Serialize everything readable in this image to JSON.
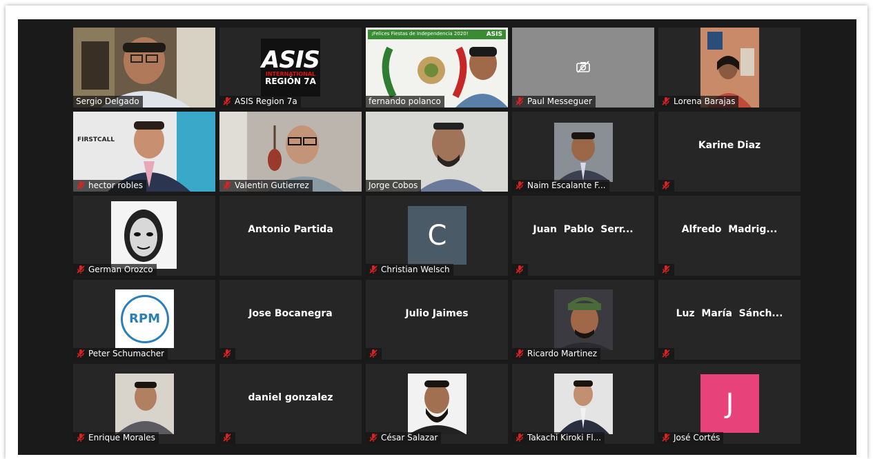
{
  "colors": {
    "stage_bg": "#1a1a1a",
    "tile_bg": "#262626",
    "active_speaker_border": "#c8e64c",
    "mic_muted": "#e02020",
    "avatar_c": "#4a5a66",
    "avatar_j": "#e8427a"
  },
  "tiles": [
    {
      "name": "Sergio Delgado",
      "muted": false
    },
    {
      "name": "ASIS Region 7a",
      "muted": true,
      "logo": {
        "line1": "ASIS",
        "line2": "INTERNATIONAL",
        "line3": "REGIÓN 7A"
      }
    },
    {
      "name": "fernando polanco",
      "muted": false,
      "active": true,
      "banner": "¡Felices Fiestas de Independencia 2020!",
      "banner_logo": "ASIS"
    },
    {
      "name": "Paul Messeguer",
      "muted": true,
      "camera_off": true
    },
    {
      "name": "Lorena Barajas",
      "muted": true
    },
    {
      "name": "hector robles",
      "muted": true,
      "logo_text": "FIRSTCALL"
    },
    {
      "name": "Valentin Gutierrez",
      "muted": true
    },
    {
      "name": "Jorge Cobos",
      "muted": false
    },
    {
      "name": "Naim Escalante F...",
      "muted": true
    },
    {
      "name": "",
      "muted": true,
      "center_name": "Karine Diaz"
    },
    {
      "name": "German Orozco",
      "muted": true
    },
    {
      "name": "",
      "muted": false,
      "center_name": "Antonio Partida"
    },
    {
      "name": "Christian Welsch",
      "muted": true,
      "avatar_letter": "C"
    },
    {
      "name": "",
      "muted": true,
      "center_name": "Juan  Pablo  Serr..."
    },
    {
      "name": "",
      "muted": true,
      "center_name": "Alfredo  Madrig..."
    },
    {
      "name": "Peter Schumacher",
      "muted": true,
      "logo_text": "RPM"
    },
    {
      "name": "",
      "muted": true,
      "center_name": "Jose Bocanegra"
    },
    {
      "name": "",
      "muted": true,
      "center_name": "Julio Jaimes"
    },
    {
      "name": "Ricardo Martinez",
      "muted": true
    },
    {
      "name": "",
      "muted": true,
      "center_name": "Luz  María  Sánch..."
    },
    {
      "name": "Enrique Morales",
      "muted": true
    },
    {
      "name": "",
      "muted": true,
      "center_name": "daniel gonzalez"
    },
    {
      "name": "César Salazar",
      "muted": true
    },
    {
      "name": "Takachi Kiroki Fl...",
      "muted": true
    },
    {
      "name": "José Cortés",
      "muted": true,
      "avatar_letter": "J"
    }
  ]
}
